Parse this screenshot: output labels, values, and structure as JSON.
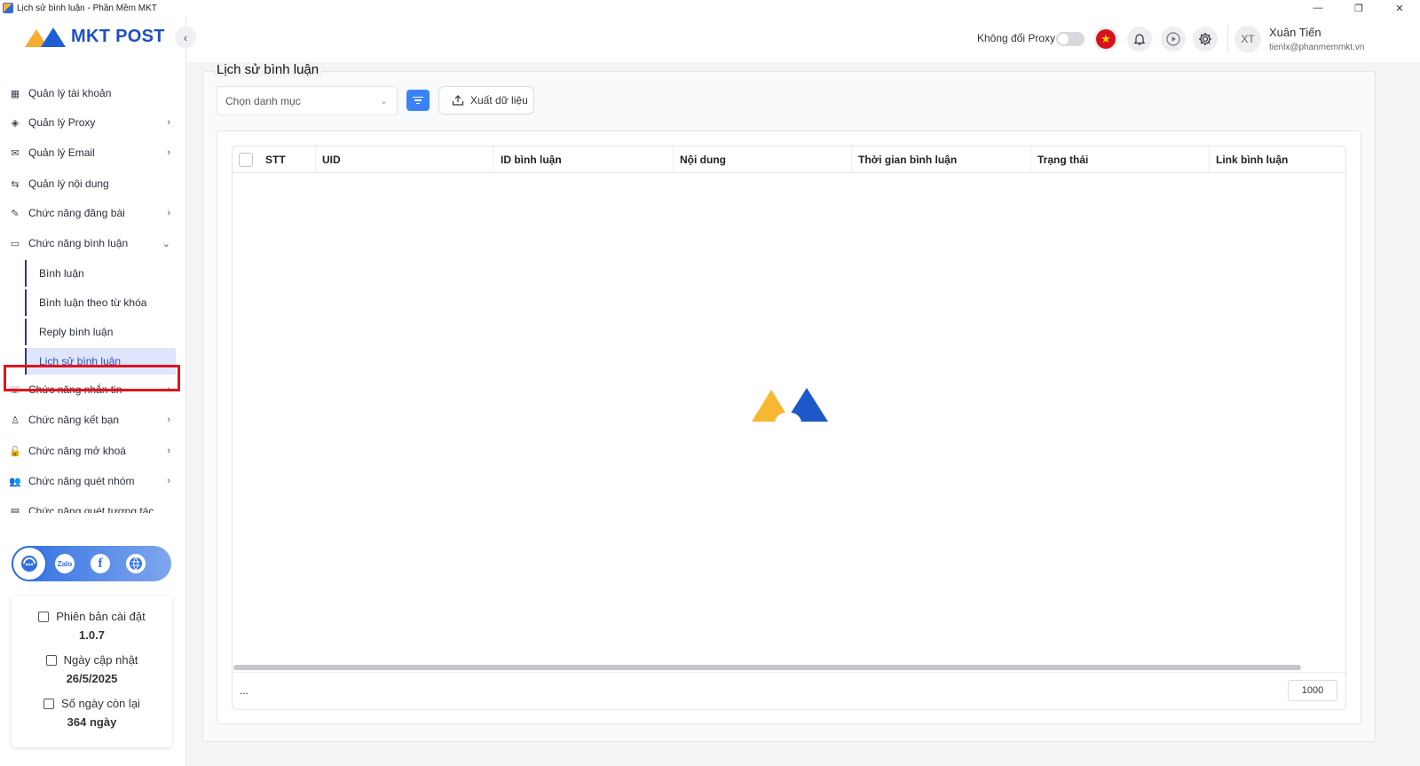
{
  "window": {
    "title": "Lịch sử bình luận - Phần Mềm MKT",
    "minimize": "—",
    "restore": "❐",
    "close": "✕"
  },
  "brand": {
    "logo_text": "MKT POST"
  },
  "sidebar": {
    "collapse_icon": "‹",
    "items": [
      {
        "label": "Quản lý tài khoản",
        "icon": "grid-icon",
        "glyph": "▦",
        "has_chevron": false
      },
      {
        "label": "Quản lý Proxy",
        "icon": "layers-icon",
        "glyph": "◈",
        "has_chevron": true
      },
      {
        "label": "Quản lý Email",
        "icon": "mail-icon",
        "glyph": "✉",
        "has_chevron": true
      },
      {
        "label": "Quản lý nội dung",
        "icon": "content-icon",
        "glyph": "⇆",
        "has_chevron": false
      },
      {
        "label": "Chức năng đăng bài",
        "icon": "post-icon",
        "glyph": "✎",
        "has_chevron": true
      },
      {
        "label": "Chức năng bình luận",
        "icon": "comment-icon",
        "glyph": "▭",
        "has_chevron": true,
        "expanded": true
      },
      {
        "label": "Chức năng nhắn tin",
        "icon": "chat-icon",
        "glyph": "☏",
        "has_chevron": true
      },
      {
        "label": "Chức năng kết bạn",
        "icon": "add-friend-icon",
        "glyph": "♙",
        "has_chevron": true
      },
      {
        "label": "Chức năng mở khoá",
        "icon": "unlock-icon",
        "glyph": "🔓",
        "has_chevron": true
      },
      {
        "label": "Chức năng quét nhóm",
        "icon": "group-icon",
        "glyph": "👥",
        "has_chevron": true
      },
      {
        "label": "Chức năng quét tương tác",
        "icon": "scan-icon",
        "glyph": "▤",
        "has_chevron": false
      }
    ],
    "sub_items": [
      {
        "label": "Bình luận",
        "active": false
      },
      {
        "label": "Bình luận theo từ khóa",
        "active": false
      },
      {
        "label": "Reply bình luận",
        "active": false
      },
      {
        "label": "Lịch sử bình luận",
        "active": true
      }
    ],
    "chevron_right": "›",
    "chevron_down": "⌄"
  },
  "social": {
    "zalo_text": "Zalo"
  },
  "info": {
    "version_label": "Phiên bản cài đặt",
    "version_value": "1.0.7",
    "update_label": "Ngày cập nhật",
    "update_value": "26/5/2025",
    "remaining_label": "Số ngày còn lại",
    "remaining_value": "364 ngày"
  },
  "header": {
    "proxy_label": "Không đổi Proxy",
    "proxy_toggle_on": false,
    "flag_star": "★",
    "avatar_initials": "XT",
    "user_name": "Xuân Tiến",
    "user_email": "tienlx@phanmemmkt.vn"
  },
  "page": {
    "title": "Lịch sử bình luận",
    "category_placeholder": "Chọn danh mục",
    "export_label": "Xuất dữ liệu"
  },
  "table": {
    "columns": [
      "STT",
      "UID",
      "ID bình luận",
      "Nội dung",
      "Thời gian bình luận",
      "Trạng thái",
      "Link bình luận"
    ],
    "rows": [],
    "footer_dots": "...",
    "page_size": "1000"
  },
  "colors": {
    "accent": "#3b82f6",
    "brand_blue": "#1d4fc4",
    "brand_orange": "#f5ad2e",
    "highlight": "#e3131b",
    "active_bg": "#dfe6fb"
  }
}
